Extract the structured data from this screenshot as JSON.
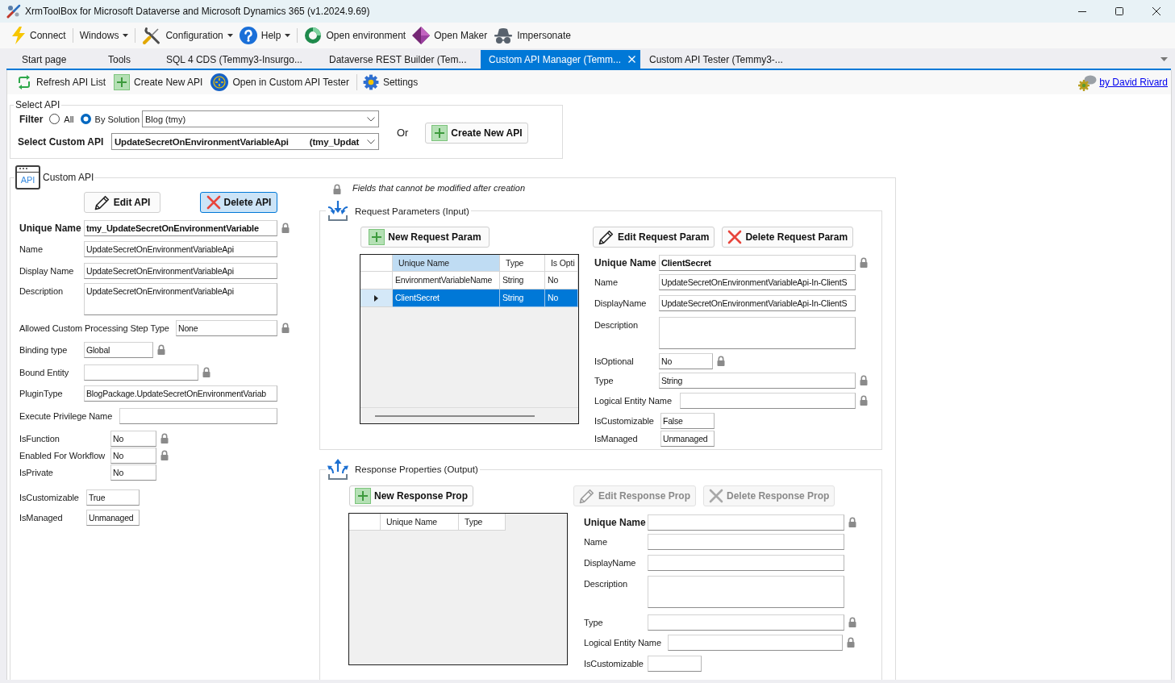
{
  "window": {
    "title": "XrmToolBox for Microsoft Dataverse and Microsoft Dynamics 365 (v1.2024.9.69)"
  },
  "menu": [
    {
      "label": "Connect",
      "dropdown": false
    },
    {
      "label": "Windows",
      "dropdown": true
    },
    {
      "label": "Configuration",
      "dropdown": true
    },
    {
      "label": "Help",
      "dropdown": true
    },
    {
      "label": "Open environment",
      "dropdown": false
    },
    {
      "label": "Open Maker",
      "dropdown": false
    },
    {
      "label": "Impersonate",
      "dropdown": false
    }
  ],
  "tabs": [
    {
      "label": "Start page",
      "selected": false
    },
    {
      "label": "Tools",
      "selected": false
    },
    {
      "label": "SQL 4 CDS (Temmy3-Insurgo...",
      "selected": false
    },
    {
      "label": "Dataverse REST Builder (Tem...",
      "selected": false
    },
    {
      "label": "Custom API Manager (Temm...",
      "selected": true
    },
    {
      "label": "Custom API Tester (Temmy3-...",
      "selected": false
    }
  ],
  "toolbar": {
    "items": [
      "Refresh API List",
      "Create New API",
      "Open in Custom API Tester",
      "Settings"
    ],
    "author_link": "by David Rivard"
  },
  "select_api": {
    "title": "Select API",
    "filter_label": "Filter",
    "filter_options": [
      {
        "label": "All",
        "selected": false
      },
      {
        "label": "By Solution",
        "selected": true
      }
    ],
    "solution": "Blog (tmy)",
    "custom_api_label": "Select Custom API",
    "custom_api": "UpdateSecretOnEnvironmentVariableApi",
    "custom_api_detail": "(tmy_Updat",
    "or_label": "Or",
    "create_button": "Create New API"
  },
  "custom_api": {
    "title": "Custom API",
    "icon_label": "API",
    "buttons": [
      {
        "label": "Edit API",
        "focused": false
      },
      {
        "label": "Delete API",
        "focused": true
      }
    ],
    "fields": [
      {
        "kind": "key",
        "label": "Unique Name",
        "value": "tmy_UpdateSecretOnEnvironmentVariable",
        "locked": true
      },
      {
        "kind": "text",
        "label": "Name",
        "value": "UpdateSecretOnEnvironmentVariableApi",
        "locked": false
      },
      {
        "kind": "text",
        "label": "Display Name",
        "value": "UpdateSecretOnEnvironmentVariableApi",
        "locked": false
      },
      {
        "kind": "multiline",
        "label": "Description",
        "value": "UpdateSecretOnEnvironmentVariableApi",
        "locked": false
      },
      {
        "kind": "text",
        "label": "Allowed Custom Processing Step Type",
        "value": "None",
        "locked": true
      },
      {
        "kind": "text",
        "label": "Binding type",
        "value": "Global",
        "locked": true
      },
      {
        "kind": "text",
        "label": "Bound Entity",
        "locked": true
      },
      {
        "kind": "text",
        "label": "PluginType",
        "value": "BlogPackage.UpdateSecretOnEnvironmentVariab",
        "locked": false
      },
      {
        "kind": "text",
        "label": "Execute Privilege Name",
        "locked": false
      },
      {
        "kind": "text",
        "label": "IsFunction",
        "value": "No",
        "locked": true
      },
      {
        "kind": "text",
        "label": "Enabled For Workflow",
        "value": "No",
        "locked": true
      },
      {
        "kind": "text",
        "label": "IsPrivate",
        "value": "No",
        "locked": false
      },
      {
        "kind": "text",
        "label": "IsCustomizable",
        "value": "True",
        "locked": false
      },
      {
        "kind": "text",
        "label": "IsManaged",
        "value": "Unmanaged",
        "locked": false
      }
    ]
  },
  "lock_note": "Fields that cannot be modified after creation",
  "request_parameters": {
    "title": "Request Parameters (Input)",
    "new_button": "New Request Param",
    "actions": [
      {
        "label": "Edit Request Param",
        "disabled": false
      },
      {
        "label": "Delete Request Param",
        "disabled": false
      }
    ],
    "table": {
      "columns": [
        {
          "label": "Unique Name",
          "selected": true
        },
        {
          "label": "Type",
          "selected": false
        },
        {
          "label": "Is Opti",
          "selected": false
        }
      ],
      "rows": [
        {
          "cells": [
            "EnvironmentVariableName",
            "String",
            "No"
          ],
          "selected": false
        },
        {
          "cells": [
            "ClientSecret",
            "String",
            "No"
          ],
          "selected": true
        }
      ]
    },
    "fields": [
      {
        "kind": "key",
        "label": "Unique Name",
        "value": "ClientSecret",
        "locked": true
      },
      {
        "kind": "text",
        "label": "Name",
        "value": "UpdateSecretOnEnvironmentVariableApi-In-ClientS",
        "locked": false
      },
      {
        "kind": "text",
        "label": "DisplayName",
        "value": "UpdateSecretOnEnvironmentVariableApi-In-ClientS",
        "locked": false
      },
      {
        "kind": "multiline",
        "label": "Description",
        "locked": false
      },
      {
        "kind": "text",
        "label": "IsOptional",
        "value": "No",
        "locked": true
      },
      {
        "kind": "text",
        "label": "Type",
        "value": "String",
        "locked": true
      },
      {
        "kind": "text",
        "label": "Logical Entity Name",
        "locked": true
      },
      {
        "kind": "text",
        "label": "IsCustomizable",
        "value": "False",
        "locked": false
      },
      {
        "kind": "text",
        "label": "IsManaged",
        "value": "Unmanaged",
        "locked": false
      }
    ]
  },
  "response_properties": {
    "title": "Response Properties (Output)",
    "new_button": "New Response Prop",
    "actions": [
      {
        "label": "Edit Response Prop",
        "disabled": true
      },
      {
        "label": "Delete Response Prop",
        "disabled": true
      }
    ],
    "table": {
      "columns": [
        {
          "label": "Unique Name",
          "selected": false
        },
        {
          "label": "Type",
          "selected": false
        }
      ]
    },
    "fields": [
      {
        "kind": "key",
        "label": "Unique Name",
        "locked": true
      },
      {
        "kind": "text",
        "label": "Name",
        "locked": false
      },
      {
        "kind": "text",
        "label": "DisplayName",
        "locked": false
      },
      {
        "kind": "multiline",
        "label": "Description",
        "locked": false
      },
      {
        "kind": "text",
        "label": "Type",
        "locked": true
      },
      {
        "kind": "text",
        "label": "Logical Entity Name",
        "locked": true
      },
      {
        "kind": "text",
        "label": "IsCustomizable",
        "locked": false
      }
    ]
  }
}
